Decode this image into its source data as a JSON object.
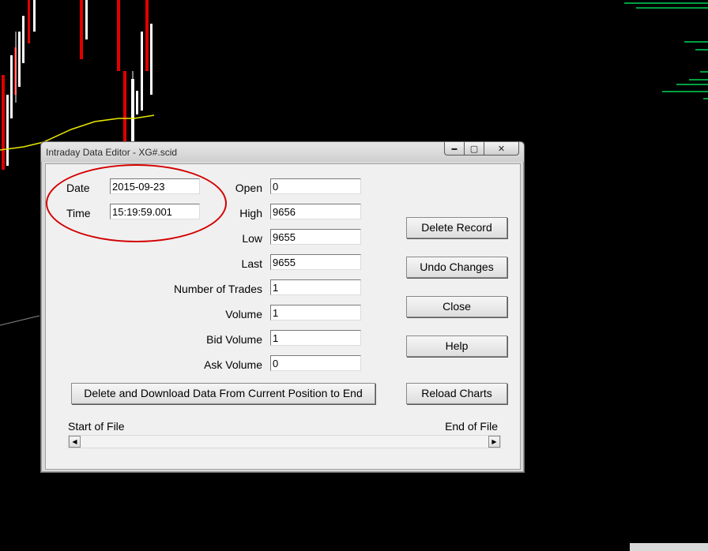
{
  "window": {
    "title": "Intraday Data Editor - XG#.scid",
    "controls": {
      "minimize": "▬",
      "maximize": "▢",
      "close": "✕"
    }
  },
  "fields": {
    "date": {
      "label": "Date",
      "value": "2015-09-23"
    },
    "time": {
      "label": "Time",
      "value": "15:19:59.001"
    },
    "open": {
      "label": "Open",
      "value": "0"
    },
    "high": {
      "label": "High",
      "value": "9656"
    },
    "low": {
      "label": "Low",
      "value": "9655"
    },
    "last": {
      "label": "Last",
      "value": "9655"
    },
    "num_trades": {
      "label": "Number of Trades",
      "value": "1"
    },
    "volume": {
      "label": "Volume",
      "value": "1"
    },
    "bid_volume": {
      "label": "Bid Volume",
      "value": "1"
    },
    "ask_volume": {
      "label": "Ask Volume",
      "value": "0"
    }
  },
  "buttons": {
    "delete_record": "Delete  Record",
    "undo_changes": "Undo Changes",
    "close": "Close",
    "help": "Help",
    "reload_charts": "Reload Charts",
    "delete_download": "Delete and Download Data From Current Position to End"
  },
  "scroll": {
    "start_label": "Start of File",
    "end_label": "End of File",
    "left_arrow": "◀",
    "right_arrow": "▶"
  },
  "colors": {
    "candle_up": "#ffffff",
    "candle_down": "#e00000",
    "moving_average": "#e8e800",
    "volume_profile": "#00a040",
    "annotation_circle": "#d40000"
  }
}
